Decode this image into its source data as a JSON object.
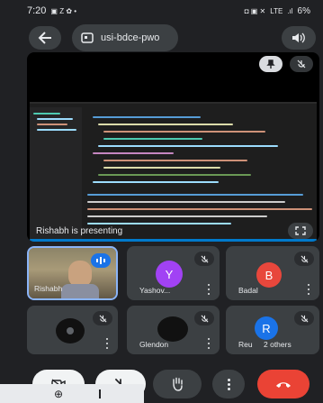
{
  "status_bar": {
    "time": "7:20",
    "network_label": "LTE",
    "battery": "6%"
  },
  "header": {
    "meeting_code": "usi-bdce-pwo"
  },
  "presentation": {
    "label": "Rishabh is presenting"
  },
  "participants": [
    {
      "name": "Rishabh",
      "type": "video"
    },
    {
      "name": "Yashov...",
      "initial": "Y",
      "color": "#a142f4"
    },
    {
      "name": "Badal",
      "initial": "B",
      "color": "#e8473c"
    },
    {
      "name": "",
      "type": "camera-off"
    },
    {
      "name": "Glendon",
      "type": "camera-off"
    },
    {
      "name": "Reu",
      "initial": "R",
      "color": "#1a73e8",
      "extra": "2 others"
    }
  ],
  "colors": {
    "background": "#202124",
    "tile": "#3c4043",
    "leave": "#ea4335"
  },
  "icons": [
    "back-arrow-icon",
    "camera-icon",
    "speaker-icon",
    "pin-icon",
    "mic-off-icon",
    "fullscreen-icon",
    "camera-off-icon",
    "hand-icon",
    "more-icon",
    "phone-icon"
  ]
}
